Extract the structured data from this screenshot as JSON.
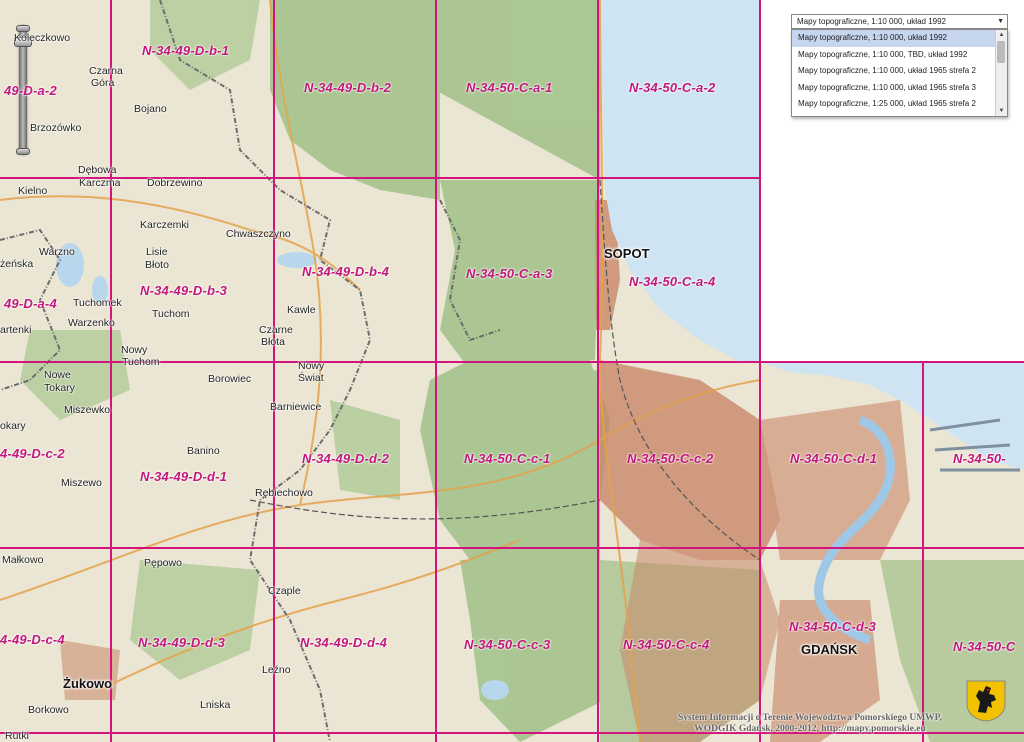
{
  "layers": {
    "selected": "Mapy topograficzne, 1:10 000, układ 1992",
    "options": [
      "Mapy topograficzne, 1:10 000, układ 1992",
      "Mapy topograficzne, 1:10 000, TBD, układ 1992",
      "Mapy topograficzne, 1:10 000, układ 1965 strefa 2",
      "Mapy topograficzne, 1:10 000, układ 1965 strefa 3",
      "Mapy topograficzne, 1:25 000, układ 1965 strefa 2"
    ]
  },
  "sheets": {
    "r1c1": "49-D-a-2",
    "r1c2": "N-34-49-D-b-1",
    "r1c3": "N-34-49-D-b-2",
    "r1c4": "N-34-50-C-a-1",
    "r1c5": "N-34-50-C-a-2",
    "r2c1": "49-D-a-4",
    "r2c2": "N-34-49-D-b-3",
    "r2c3": "N-34-49-D-b-4",
    "r2c4": "N-34-50-C-a-3",
    "r2c5": "N-34-50-C-a-4",
    "r3c1": "4-49-D-c-2",
    "r3c2": "N-34-49-D-d-1",
    "r3c3": "N-34-49-D-d-2",
    "r3c4": "N-34-50-C-c-1",
    "r3c5": "N-34-50-C-c-2",
    "r3c6": "N-34-50-C-d-1",
    "r3c7": "N-34-50-",
    "r4c1": "4-49-D-c-4",
    "r4c2": "N-34-49-D-d-3",
    "r4c3": "N-34-49-D-d-4",
    "r4c4": "N-34-50-C-c-3",
    "r4c5": "N-34-50-C-c-4",
    "r4c6": "N-34-50-C-d-3",
    "r4c7": "N-34-50-C"
  },
  "places": {
    "koleczkowo": "Koleczkowo",
    "czarna_gora_1": "Czarna",
    "czarna_gora_2": "Góra",
    "bojano": "Bojano",
    "brzozowko": "Brzozówko",
    "debowa_1": "Dębowa",
    "debowa_2": "Karczma",
    "dobrzewino": "Dobrzewino",
    "kielno": "Kielno",
    "karczemki": "Karczemki",
    "chwaszczyno": "Chwaszczyno",
    "warzno": "Warzno",
    "lisie_1": "Lisie",
    "lisie_2": "Błoto",
    "zenska": "żeńska",
    "tuchomek": "Tuchomek",
    "tuchom": "Tuchom",
    "kawle": "Kawle",
    "artenki": "artenki",
    "warzenko": "Warzenko",
    "czarne_1": "Czarne",
    "czarne_2": "Błota",
    "nowy_tuchom_1": "Nowy",
    "nowy_tuchom_2": "Tuchom",
    "nowy_swiat_1": "Nowy",
    "nowy_swiat_2": "Świat",
    "nowe_1": "Nowe",
    "nowe_2": "Tokary",
    "borowiec": "Borowiec",
    "miszewko": "Miszewko",
    "barniewice": "Barniewice",
    "tokary": "okary",
    "banino": "Banino",
    "miszewo": "Miszewo",
    "rebiechowo": "Rębiechowo",
    "malkowo": "Małkowo",
    "pepowo": "Pępowo",
    "czaple": "Czaple",
    "lezno": "Leźno",
    "borkowo": "Borkowo",
    "lniska": "Lniska",
    "rutki": "Rutki"
  },
  "cities": {
    "sopot": "SOPOT",
    "gdansk": "GDAŃSK",
    "zukowo": "Żukowo"
  },
  "footer": {
    "line1": "System Informacji o Terenie Województwa Pomorskiego UMWP,",
    "line2": "WODGIK Gdańsk, 2000-2012, http://mapy.pomorskie.eu"
  },
  "colors": {
    "grid": "#d4147e",
    "sea": "#cfe4f2",
    "forest": "#a3c089",
    "urban": "#c98a6a",
    "field": "#ebe5d3"
  },
  "icons": {
    "zoom": "zoom-slider",
    "coat_of_arms": "griffin-coat-of-arms-icon"
  }
}
